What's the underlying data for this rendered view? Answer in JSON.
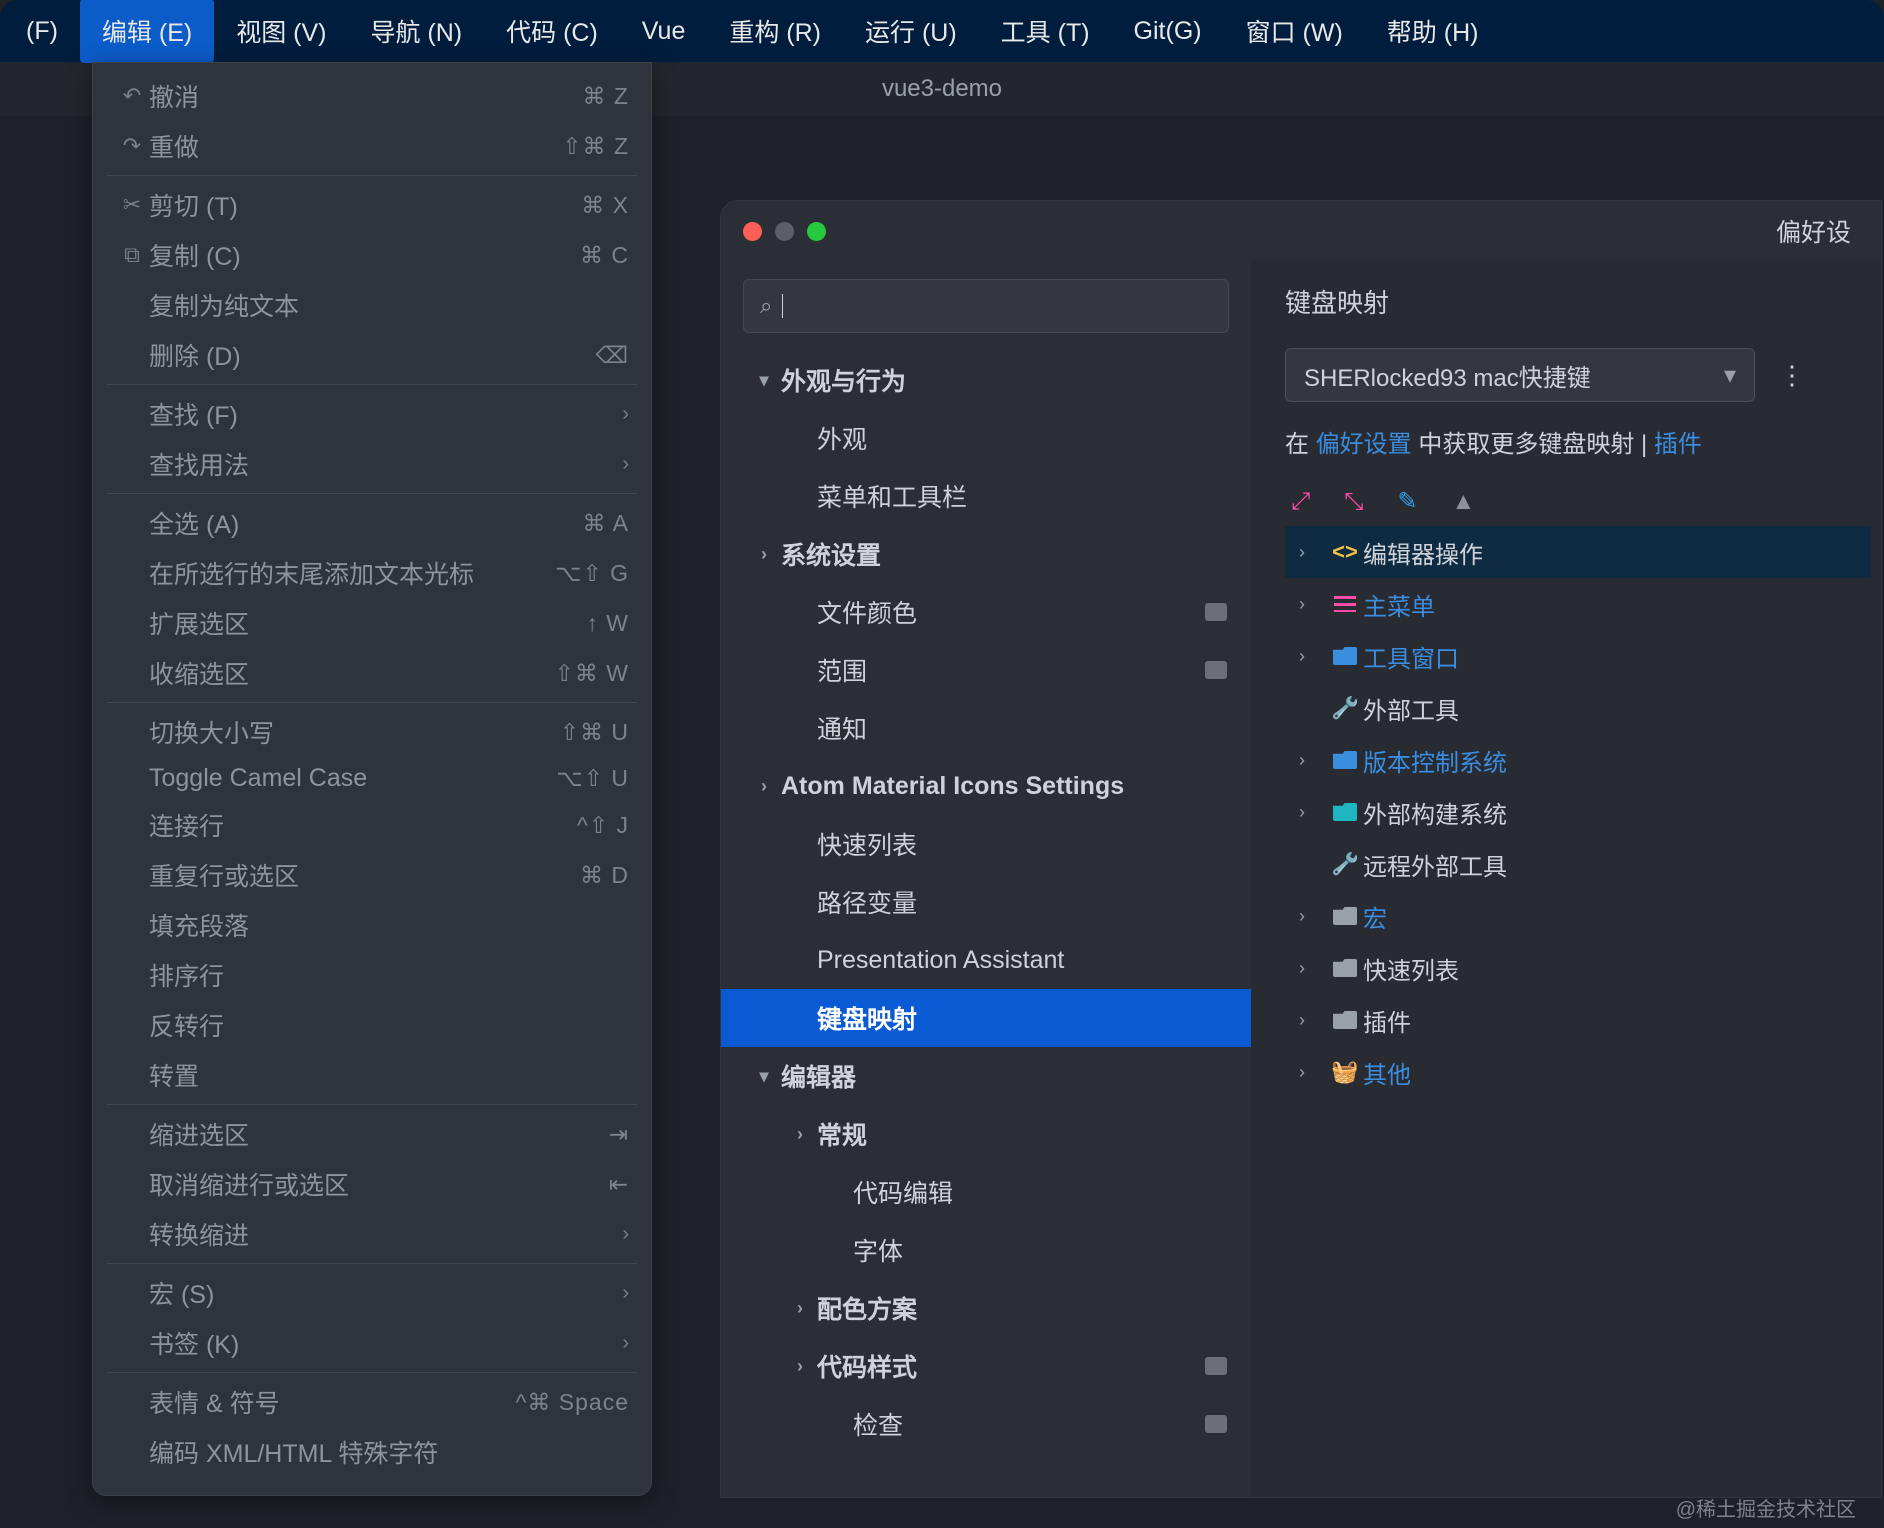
{
  "menubar": {
    "items": [
      "(F)",
      "编辑 (E)",
      "视图 (V)",
      "导航 (N)",
      "代码 (C)",
      "Vue",
      "重构 (R)",
      "运行 (U)",
      "工具 (T)",
      "Git(G)",
      "窗口 (W)",
      "帮助 (H)"
    ],
    "active_index": 1
  },
  "project_title": "vue3-demo",
  "edit_menu": {
    "groups": [
      [
        {
          "icon": "↶",
          "label": "撤消",
          "shortcut": "⌘ Z"
        },
        {
          "icon": "↷",
          "label": "重做",
          "shortcut": "⇧⌘ Z"
        }
      ],
      [
        {
          "icon": "✂",
          "label": "剪切 (T)",
          "shortcut": "⌘ X"
        },
        {
          "icon": "⧉",
          "label": "复制 (C)",
          "shortcut": "⌘ C"
        },
        {
          "icon": "",
          "label": "复制为纯文本",
          "shortcut": ""
        },
        {
          "icon": "",
          "label": "删除 (D)",
          "shortcut": "",
          "trail": "⌫"
        }
      ],
      [
        {
          "icon": "",
          "label": "查找 (F)",
          "submenu": true
        },
        {
          "icon": "",
          "label": "查找用法",
          "submenu": true
        }
      ],
      [
        {
          "icon": "",
          "label": "全选 (A)",
          "shortcut": "⌘ A"
        },
        {
          "icon": "",
          "label": "在所选行的末尾添加文本光标",
          "shortcut": "⌥⇧ G"
        },
        {
          "icon": "",
          "label": "扩展选区",
          "shortcut": "↑ W"
        },
        {
          "icon": "",
          "label": "收缩选区",
          "shortcut": "⇧⌘ W"
        }
      ],
      [
        {
          "icon": "",
          "label": "切换大小写",
          "shortcut": "⇧⌘ U"
        },
        {
          "icon": "",
          "label": "Toggle Camel Case",
          "shortcut": "⌥⇧ U"
        },
        {
          "icon": "",
          "label": "连接行",
          "shortcut": "^⇧ J"
        },
        {
          "icon": "",
          "label": "重复行或选区",
          "shortcut": "⌘ D"
        },
        {
          "icon": "",
          "label": "填充段落",
          "shortcut": ""
        },
        {
          "icon": "",
          "label": "排序行",
          "shortcut": ""
        },
        {
          "icon": "",
          "label": "反转行",
          "shortcut": ""
        },
        {
          "icon": "",
          "label": "转置",
          "shortcut": ""
        }
      ],
      [
        {
          "icon": "",
          "label": "缩进选区",
          "shortcut": "",
          "trail": "⇥"
        },
        {
          "icon": "",
          "label": "取消缩进行或选区",
          "shortcut": "",
          "trail": "⇤"
        },
        {
          "icon": "",
          "label": "转换缩进",
          "submenu": true
        }
      ],
      [
        {
          "icon": "",
          "label": "宏 (S)",
          "submenu": true
        },
        {
          "icon": "",
          "label": "书签 (K)",
          "submenu": true
        }
      ],
      [
        {
          "icon": "",
          "label": "表情 & 符号",
          "shortcut": "^⌘ Space"
        },
        {
          "icon": "",
          "label": "编码 XML/HTML 特殊字符",
          "shortcut": ""
        }
      ]
    ]
  },
  "prefs": {
    "window_title": "偏好设",
    "nav": [
      {
        "depth": 0,
        "expand": "▾",
        "label": "外观与行为",
        "bold": true
      },
      {
        "depth": 1,
        "label": "外观"
      },
      {
        "depth": 1,
        "label": "菜单和工具栏"
      },
      {
        "depth": 0,
        "expand": "›",
        "label": "系统设置",
        "bold": true
      },
      {
        "depth": 1,
        "label": "文件颜色",
        "badge": true
      },
      {
        "depth": 1,
        "label": "范围",
        "badge": true
      },
      {
        "depth": 1,
        "label": "通知"
      },
      {
        "depth": 0,
        "expand": "›",
        "label": "Atom Material Icons Settings",
        "bold": true
      },
      {
        "depth": 1,
        "label": "快速列表"
      },
      {
        "depth": 1,
        "label": "路径变量"
      },
      {
        "depth": 1,
        "label": "Presentation Assistant"
      },
      {
        "depth": 1,
        "label": "键盘映射",
        "selected": true,
        "bold": true
      },
      {
        "depth": 0,
        "expand": "▾",
        "label": "编辑器",
        "bold": true
      },
      {
        "depth": 1,
        "expand": "›",
        "label": "常规",
        "bold": true
      },
      {
        "depth": 2,
        "label": "代码编辑"
      },
      {
        "depth": 2,
        "label": "字体"
      },
      {
        "depth": 1,
        "expand": "›",
        "label": "配色方案",
        "bold": true
      },
      {
        "depth": 1,
        "expand": "›",
        "label": "代码样式",
        "bold": true,
        "badge": true
      },
      {
        "depth": 2,
        "label": "检查",
        "badge": true
      }
    ],
    "main": {
      "title": "键盘映射",
      "keymap_name": "SHERlocked93 mac快捷键",
      "link_prefix": "在 ",
      "link_pref": "偏好设置",
      "link_mid": " 中获取更多键盘映射",
      "link_sep": " | ",
      "link_plugin": "插件",
      "tree": [
        {
          "selected": true,
          "icon": "code",
          "label": "编辑器操作",
          "color": "plain"
        },
        {
          "icon": "menu",
          "label": "主菜单",
          "color": "blue"
        },
        {
          "icon": "folder-blue",
          "label": "工具窗口",
          "color": "blue"
        },
        {
          "noarrow": true,
          "icon": "wrench",
          "label": "外部工具",
          "color": "plain"
        },
        {
          "icon": "folder-blue",
          "label": "版本控制系统",
          "color": "blue"
        },
        {
          "icon": "folder-teal",
          "label": "外部构建系统",
          "color": "plain"
        },
        {
          "noarrow": true,
          "icon": "wrench",
          "label": "远程外部工具",
          "color": "plain"
        },
        {
          "icon": "folder-gray",
          "label": "宏",
          "color": "blue"
        },
        {
          "icon": "folder-gray",
          "label": "快速列表",
          "color": "plain"
        },
        {
          "icon": "folder-gray",
          "label": "插件",
          "color": "plain"
        },
        {
          "icon": "basket",
          "label": "其他",
          "color": "blue"
        }
      ]
    }
  },
  "watermark": "@稀土掘金技术社区"
}
